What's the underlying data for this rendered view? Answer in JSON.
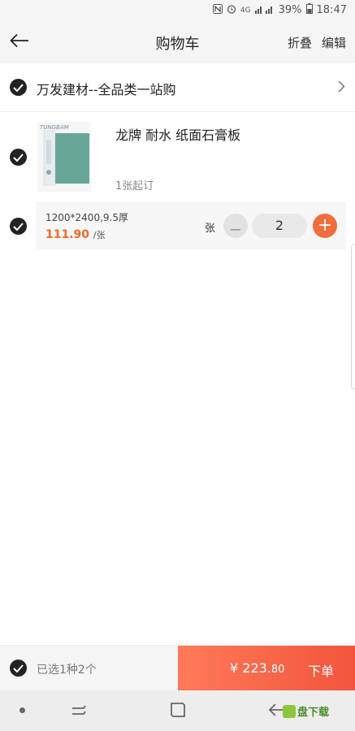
{
  "status_bar": {
    "battery": "39%",
    "time": "18:47",
    "network": "4G",
    "icons": [
      "nfc-icon",
      "alarm-icon",
      "signal-icon",
      "battery-icon"
    ]
  },
  "nav": {
    "title": "购物车",
    "fold_label": "折叠",
    "edit_label": "编辑",
    "back_icon": "back-arrow-icon"
  },
  "shop": {
    "name": "万发建材--全品类一站购",
    "arrow_icon": "chevron-right-icon"
  },
  "product": {
    "title": "龙牌 耐水 纸面石膏板",
    "moq": "1张起订",
    "thumbnail": "product-thumbnail"
  },
  "sku": {
    "spec": "1200*2400,9.5厚",
    "price": "111.90",
    "price_unit": "/张",
    "unit": "张",
    "quantity": "2"
  },
  "footer": {
    "selected_text": "已选1种2个",
    "total_main": "¥ 223.",
    "total_cents": "80",
    "order_label": "下单"
  },
  "watermark": {
    "text": "盘下载"
  },
  "colors": {
    "accent": "#f26d3d",
    "price": "#f0692a",
    "checkout_start": "#ff7a5a",
    "checkout_end": "#f2553c"
  }
}
